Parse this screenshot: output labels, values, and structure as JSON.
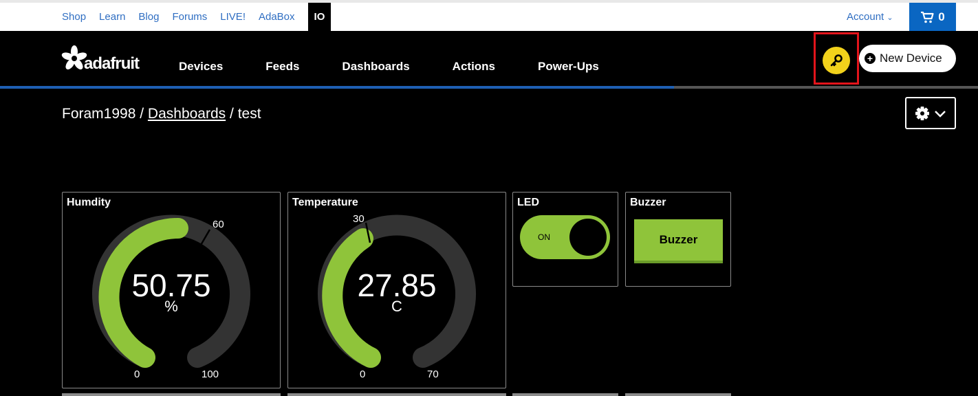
{
  "top_links": [
    "Shop",
    "Learn",
    "Blog",
    "Forums",
    "LIVE!",
    "AdaBox",
    "IO"
  ],
  "account_label": "Account",
  "cart_count": "0",
  "logo_text": "adafruit",
  "nav": [
    "Devices",
    "Feeds",
    "Dashboards",
    "Actions",
    "Power-Ups"
  ],
  "new_device_label": "New Device",
  "breadcrumb": {
    "user": "Foram1998",
    "sep1": "/",
    "link": "Dashboards",
    "sep2": "/",
    "page": "test"
  },
  "blocks": {
    "humidity": {
      "title": "Humdity",
      "value": "50.75",
      "unit": "%",
      "min": "0",
      "max": "100",
      "mark": "60"
    },
    "temperature": {
      "title": "Temperature",
      "value": "27.85",
      "unit": "C",
      "min": "0",
      "max": "70",
      "mark": "30"
    },
    "led": {
      "title": "LED",
      "state": "ON"
    },
    "buzzer": {
      "title": "Buzzer",
      "button_label": "Buzzer"
    }
  },
  "colors": {
    "accent_green": "#8fc43a",
    "key_yellow": "#f2d21b",
    "link_blue": "#2f6ec2",
    "highlight_red": "#e3141b"
  }
}
